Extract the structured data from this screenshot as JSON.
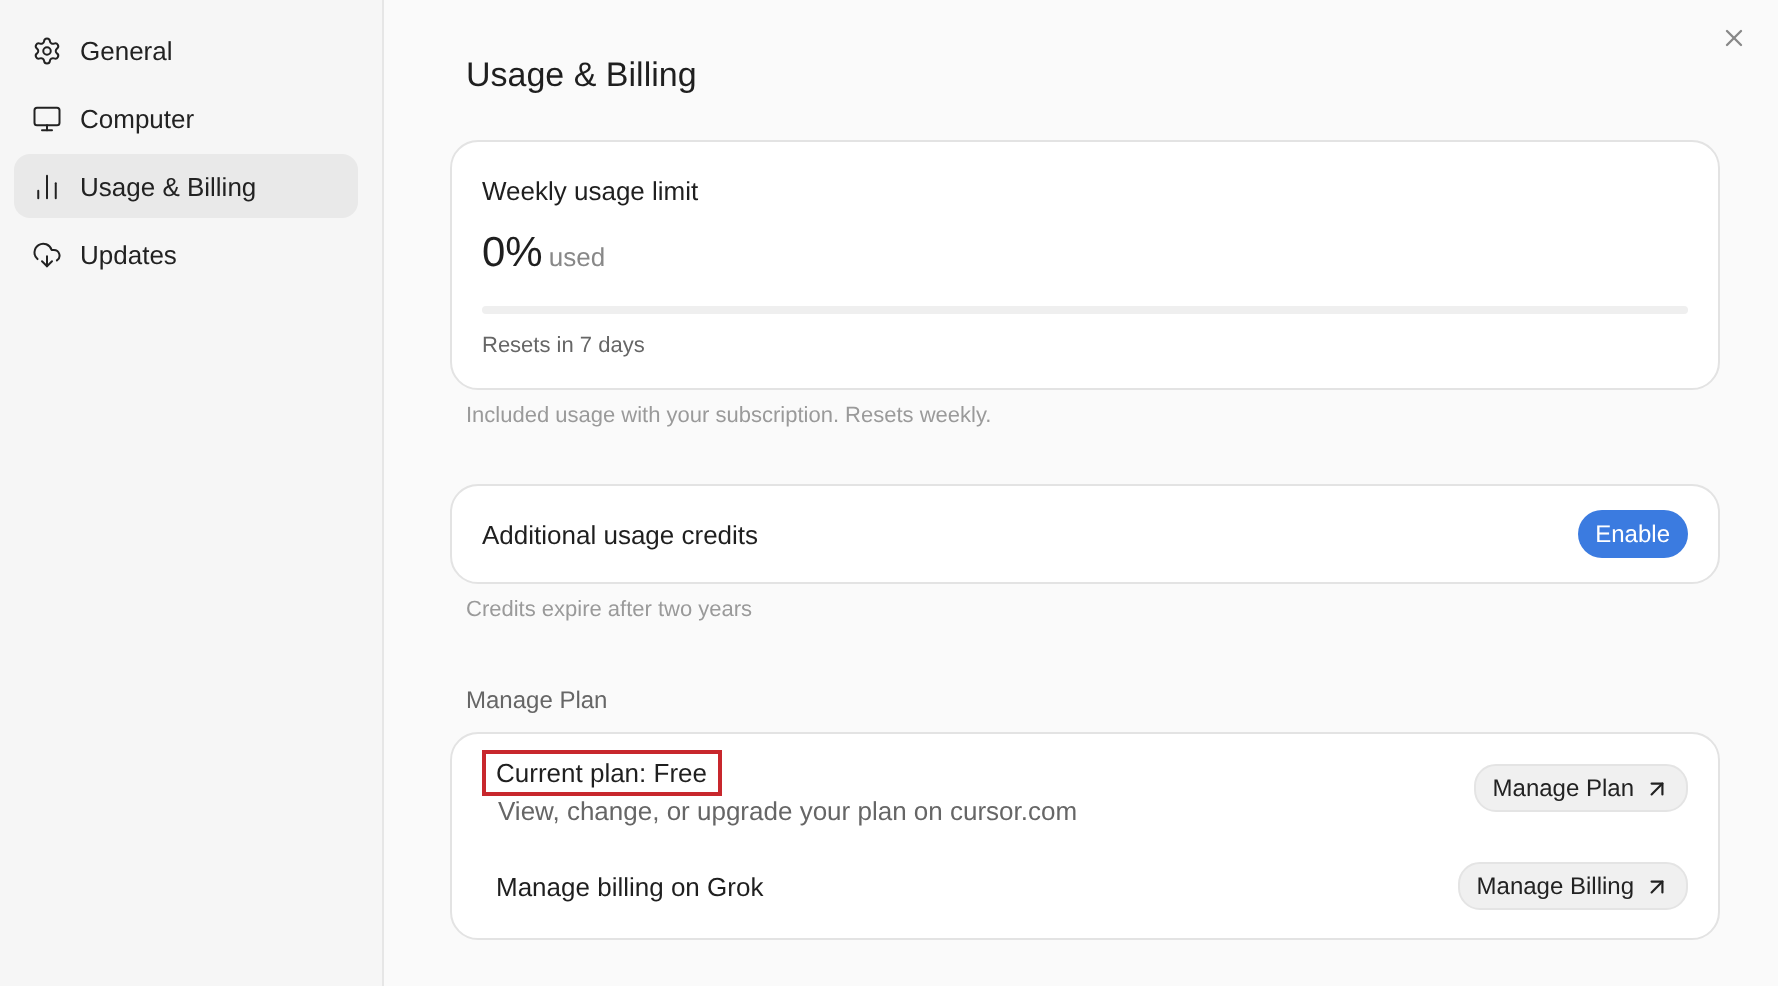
{
  "sidebar": {
    "items": [
      {
        "label": "General",
        "selected": false
      },
      {
        "label": "Computer",
        "selected": false
      },
      {
        "label": "Usage & Billing",
        "selected": true
      },
      {
        "label": "Updates",
        "selected": false
      }
    ]
  },
  "page": {
    "title": "Usage & Billing"
  },
  "usage_card": {
    "title": "Weekly usage limit",
    "percent": "0%",
    "unit": "used",
    "level": 0,
    "reset": "Resets in 7 days"
  },
  "usage_note": "Included usage with your subscription. Resets weekly.",
  "credits_card": {
    "label": "Additional usage credits",
    "button": "Enable"
  },
  "credits_note": "Credits expire after two years",
  "plan_section": {
    "heading": "Manage Plan",
    "rows": [
      {
        "title": "Current plan: Free",
        "subtitle": "View, change, or upgrade your plan on cursor.com",
        "button": "Manage Plan",
        "highlighted": true
      },
      {
        "title": "Manage billing on Grok",
        "button": "Manage Billing",
        "highlighted": false
      }
    ]
  }
}
